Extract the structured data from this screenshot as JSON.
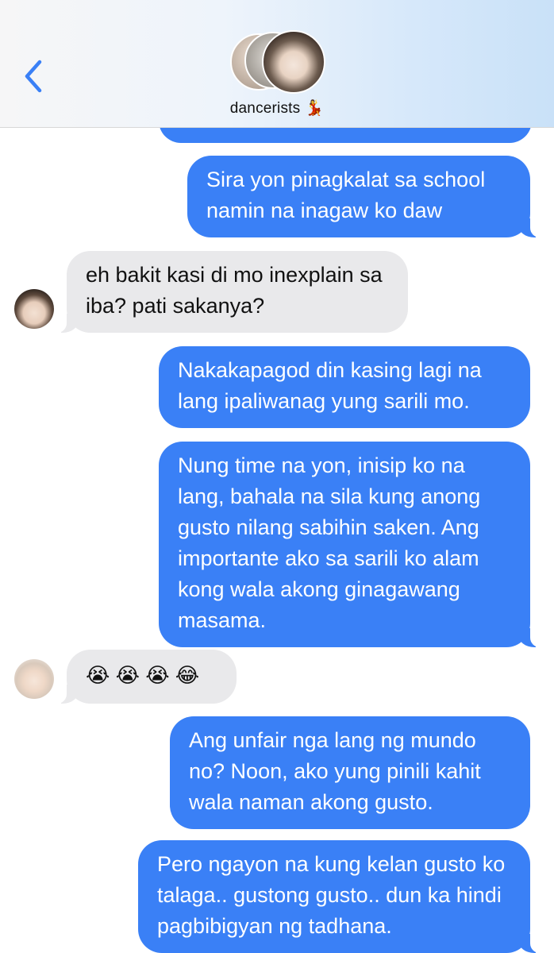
{
  "header": {
    "group_name": "dancerists",
    "group_emoji": "💃",
    "back_icon": "chevron-left-icon"
  },
  "colors": {
    "outgoing_bubble": "#3a80f6",
    "incoming_bubble": "#e9e9eb",
    "accent": "#3a80f6"
  },
  "messages": [
    {
      "direction": "out",
      "text": "Sira yon pinagkalat sa school namin na inagaw ko daw"
    },
    {
      "direction": "in",
      "text": "eh bakit kasi di mo inexplain sa iba? pati sakanya?"
    },
    {
      "direction": "out",
      "text": "Nakakapagod din kasing lagi na lang ipaliwanag yung sarili mo."
    },
    {
      "direction": "out",
      "text": "Nung time na yon, inisip ko na lang, bahala na sila kung anong gusto nilang sabihin saken. Ang importante ako sa sarili ko alam kong wala akong ginagawang masama."
    },
    {
      "direction": "in",
      "text": "😭 😭 😭 😂"
    },
    {
      "direction": "out",
      "text": "Ang unfair nga lang ng mundo no? Noon, ako yung pinili kahit wala naman akong gusto."
    },
    {
      "direction": "out",
      "text": "Pero ngayon na kung kelan gusto ko talaga.. gustong gusto.. dun ka hindi pagbibigyan ng tadhana."
    }
  ]
}
